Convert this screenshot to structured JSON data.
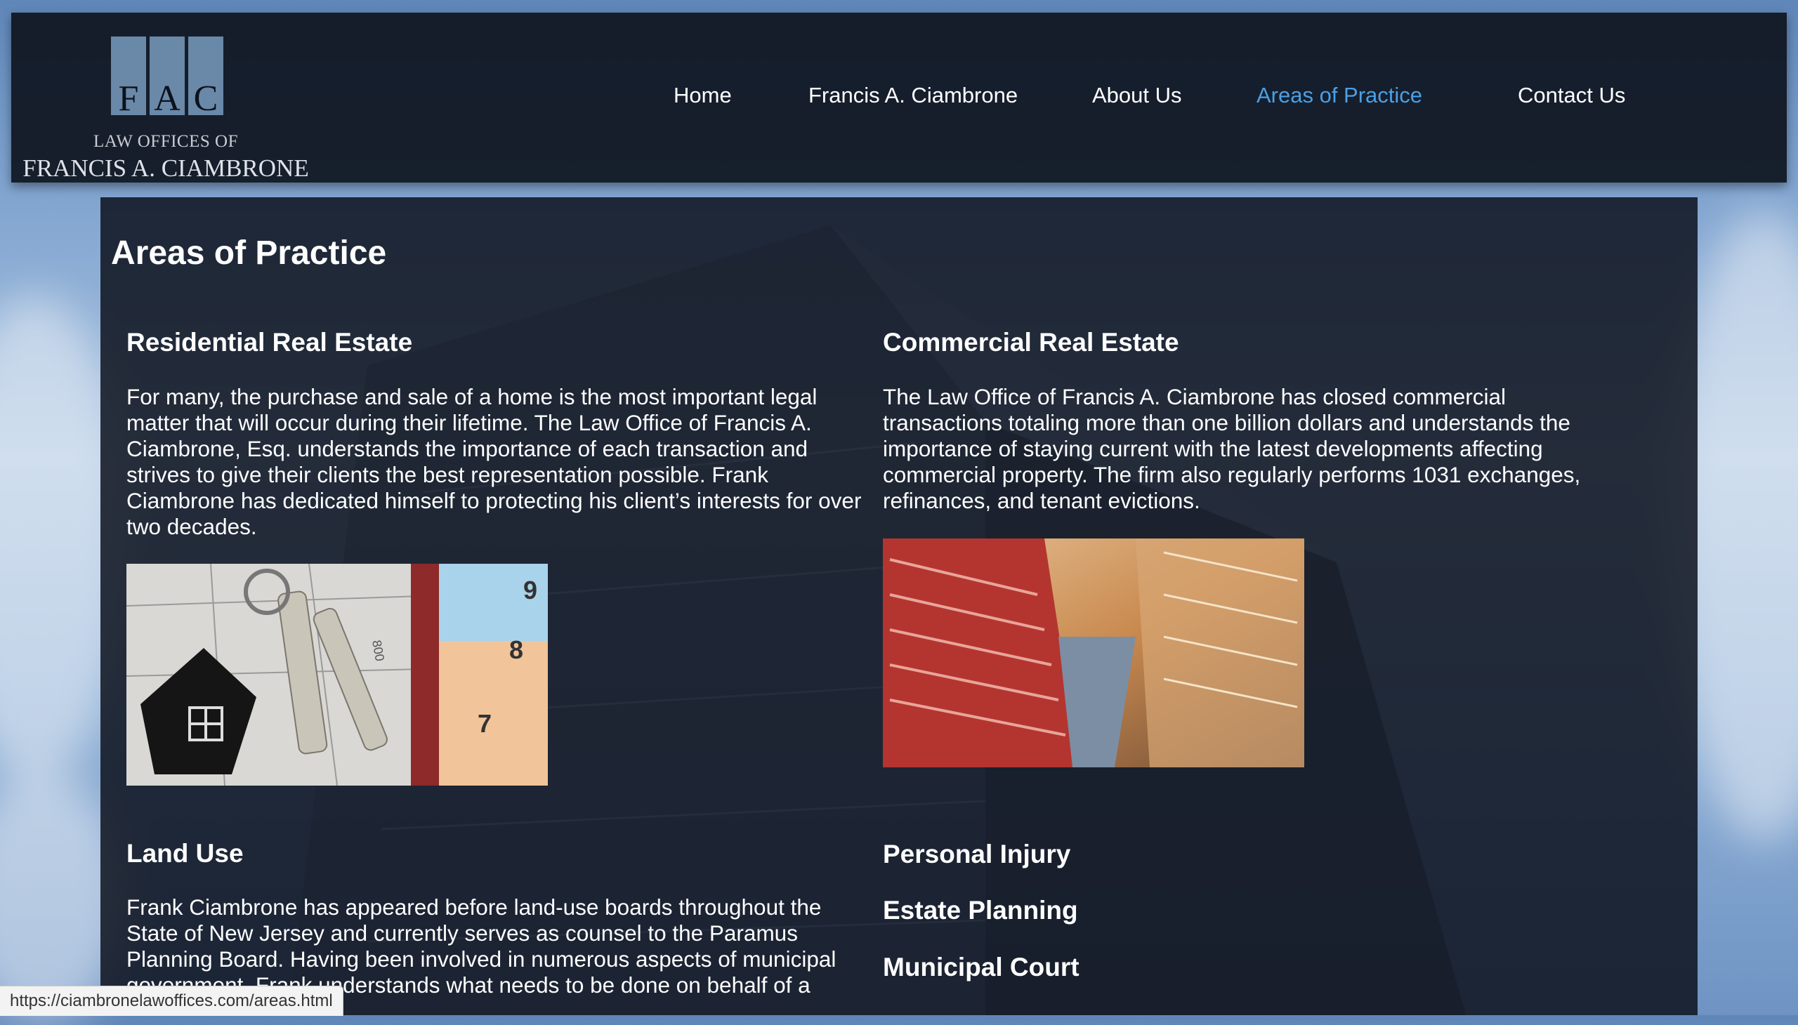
{
  "logo": {
    "letters": [
      "F",
      "A",
      "C"
    ],
    "line1": "LAW OFFICES OF",
    "line2": "FRANCIS A. CIAMBRONE"
  },
  "nav": {
    "items": [
      {
        "label": "Home"
      },
      {
        "label": "Francis A. Ciambrone"
      },
      {
        "label": "About Us"
      },
      {
        "label": "Areas of Practice"
      },
      {
        "label": "Contact Us"
      }
    ],
    "active": "Areas of Practice",
    "active_color": "#4aa0e6"
  },
  "page": {
    "title": "Areas of Practice"
  },
  "sections": {
    "residential": {
      "title": "Residential Real Estate",
      "body": "For many, the purchase and sale of a home is the most important legal matter that will occur during their lifetime. The Law Office of Francis A. Ciambrone, Esq. understands the importance of each transaction and strives to give their clients the best representation possible. Frank Ciambrone has dedicated himself to protecting his client’s interests for over two decades.",
      "image_labels": [
        "9",
        "8",
        "7",
        "800"
      ]
    },
    "commercial": {
      "title": "Commercial Real Estate",
      "body": "The Law Office of Francis A. Ciambrone has closed commercial transactions totaling more than one billion dollars and understands the importance of staying current with the latest developments affecting commercial property. The firm also regularly performs 1031 exchanges, refinances, and tenant evictions."
    },
    "land_use": {
      "title": "Land Use",
      "body": "Frank Ciambrone has appeared before land-use boards throughout the State of New Jersey and currently serves as counsel to the Paramus Planning Board. Having been involved in numerous aspects of municipal government, Frank understands what needs to be done on behalf of a"
    },
    "other": [
      {
        "title": "Personal Injury"
      },
      {
        "title": "Estate Planning"
      },
      {
        "title": "Municipal Court"
      }
    ]
  },
  "status_bar": {
    "url": "https://ciambronelawoffices.com/areas.html"
  }
}
